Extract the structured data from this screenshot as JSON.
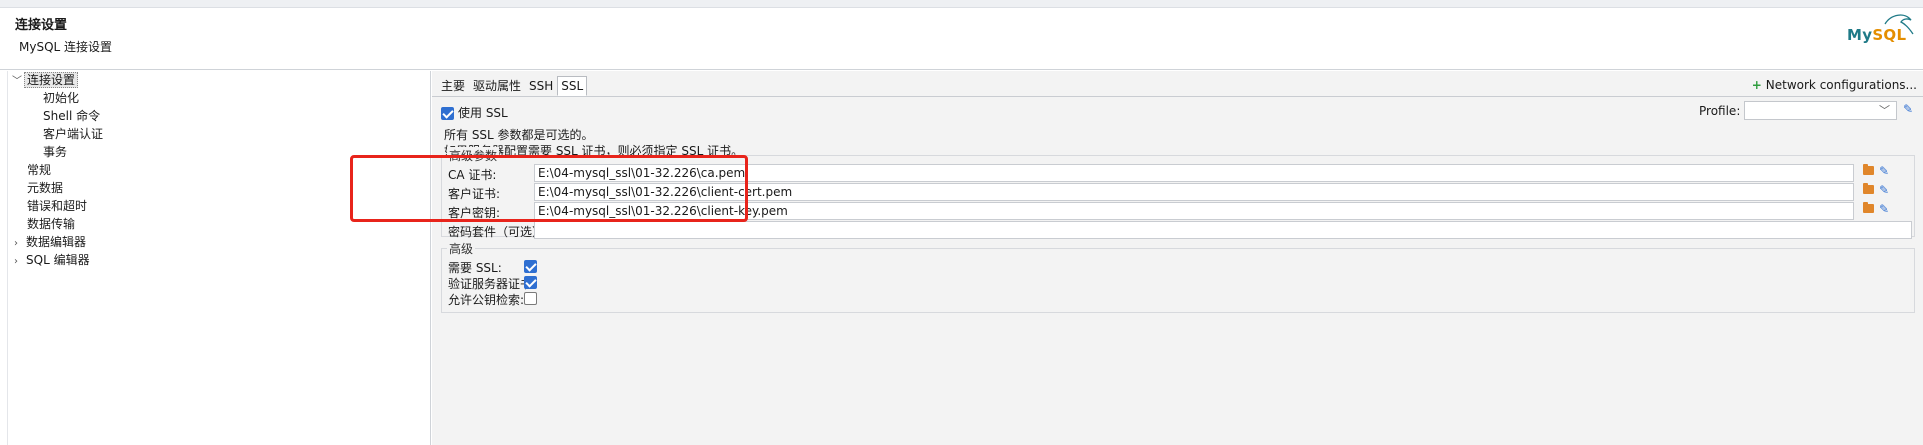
{
  "header": {
    "title": "连接设置",
    "subtitle": "MySQL 连接设置",
    "logo_text_a": "My",
    "logo_text_b": "SQL"
  },
  "sidebar": {
    "items": [
      {
        "label": "连接设置",
        "expanded": true,
        "selected": true
      },
      {
        "label": "初始化"
      },
      {
        "label": "Shell 命令"
      },
      {
        "label": "客户端认证"
      },
      {
        "label": "事务"
      },
      {
        "label": "常规"
      },
      {
        "label": "元数据"
      },
      {
        "label": "错误和超时"
      },
      {
        "label": "数据传输"
      },
      {
        "label": "数据编辑器",
        "collapsed": true
      },
      {
        "label": "SQL 编辑器",
        "collapsed": true
      }
    ]
  },
  "tabs": [
    {
      "label": "主要"
    },
    {
      "label": "驱动属性"
    },
    {
      "label": "SSH"
    },
    {
      "label": "SSL",
      "active": true
    }
  ],
  "network_config": {
    "plus": "+",
    "label": "Network configurations..."
  },
  "use_ssl": {
    "label": "使用 SSL",
    "checked": true
  },
  "profile": {
    "label": "Profile:",
    "value": ""
  },
  "notes": {
    "line1": "所有 SSL 参数都是可选的。",
    "line2": "如果服务器配置需要 SSL 证书，则必须指定 SSL 证书。"
  },
  "params_group": {
    "title": "高级参数",
    "fields": [
      {
        "label": "CA 证书:",
        "value": "E:\\04-mysql_ssl\\01-32.226\\ca.pem"
      },
      {
        "label": "客户证书:",
        "value": "E:\\04-mysql_ssl\\01-32.226\\client-cert.pem"
      },
      {
        "label": "客户密钥:",
        "value": "E:\\04-mysql_ssl\\01-32.226\\client-key.pem"
      },
      {
        "label": "密码套件（可选）:",
        "value": ""
      }
    ]
  },
  "advanced_group": {
    "title": "高级",
    "options": [
      {
        "label": "需要 SSL:",
        "checked": true
      },
      {
        "label": "验证服务器证书:",
        "checked": true
      },
      {
        "label": "允许公钥检索:",
        "checked": false
      }
    ]
  },
  "colors": {
    "accent": "#2f6fd1",
    "highlight": "#e8241b",
    "folder": "#e0862a",
    "add": "#2e9d3e"
  }
}
